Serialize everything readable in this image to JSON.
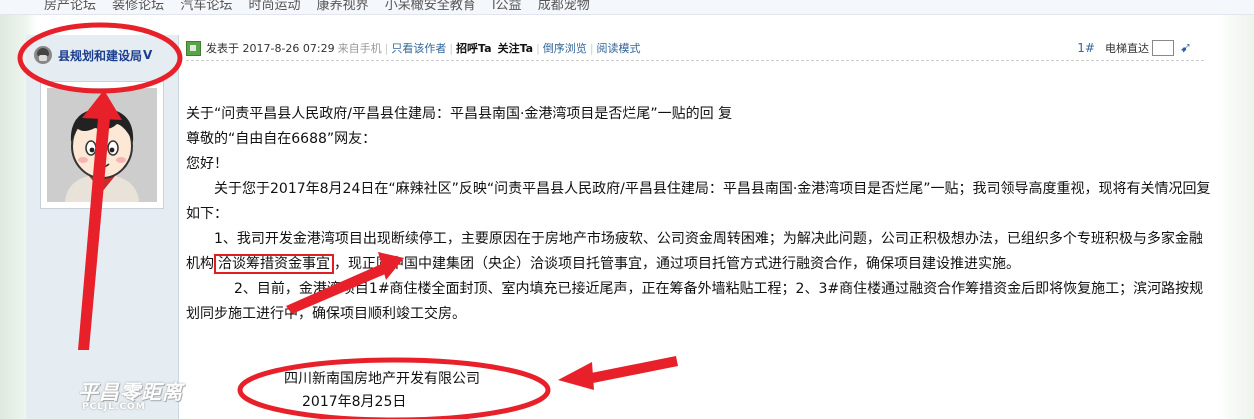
{
  "topnav": [
    "房产论坛",
    "装修论坛",
    "汽车论坛",
    "时尚运动",
    "康养视界",
    "小呆橄安全教育",
    "l公益",
    "成都宠物"
  ],
  "author": {
    "name": "县规划和建设局",
    "badge": "V"
  },
  "post_info": {
    "posted_label": "发表于 2017-8-26 07:29",
    "source": "来自手机",
    "only_author": "只看该作者",
    "greet": "招呼Ta",
    "follow": "关注Ta",
    "reverse": "倒序浏览",
    "reading_mode": "阅读模式",
    "floor": "1#",
    "jump_label": "电梯直达"
  },
  "content": {
    "title_line": "关于“问责平昌县人民政府/平昌县住建局：平昌县南国·金港湾项目是否烂尾”一贴的回  复",
    "greeting": "尊敬的“自由自在6688”网友：",
    "hello": "您好！",
    "para1": "关于您于2017年8月24日在“麻辣社区”反映“问责平昌县人民政府/平昌县住建局：平昌县南国·金港湾项目是否烂尾”一贴；我司领导高度重视，现将有关情况回复如下：",
    "para2_a": "1、我司开发金港湾项目出现断续停工，主要原因在于房地产市场疲软、公司资金周转困难；为解决此问题，公司正积极想办法，已组织多个专班积极与多家金融机构",
    "para2_highlight": "洽谈筹措资金事宜",
    "para2_b": "，现正同中国中建集团（央企）洽谈项目托管事宜，通过项目托管方式进行融资合作，确保项目建设推进实施。",
    "para3": "2、目前，金港湾项目1#商住楼全面封顶、室内填充已接近尾声，正在筹备外墙粘贴工程；2、3#商住楼通过融资合作筹措资金后即将恢复施工；滨河路按规划同步施工进行中，确保项目顺利竣工交房。",
    "signature_company": "四川新南国房地产开发有限公司",
    "signature_date": "2017年8月25日"
  },
  "watermark": {
    "main": "平昌零距离",
    "sub": "PCLJL.COM"
  },
  "colors": {
    "annotation": "#e8202a",
    "link": "#336699",
    "author": "#1a3d8f",
    "sidebar": "#e5edf2"
  }
}
